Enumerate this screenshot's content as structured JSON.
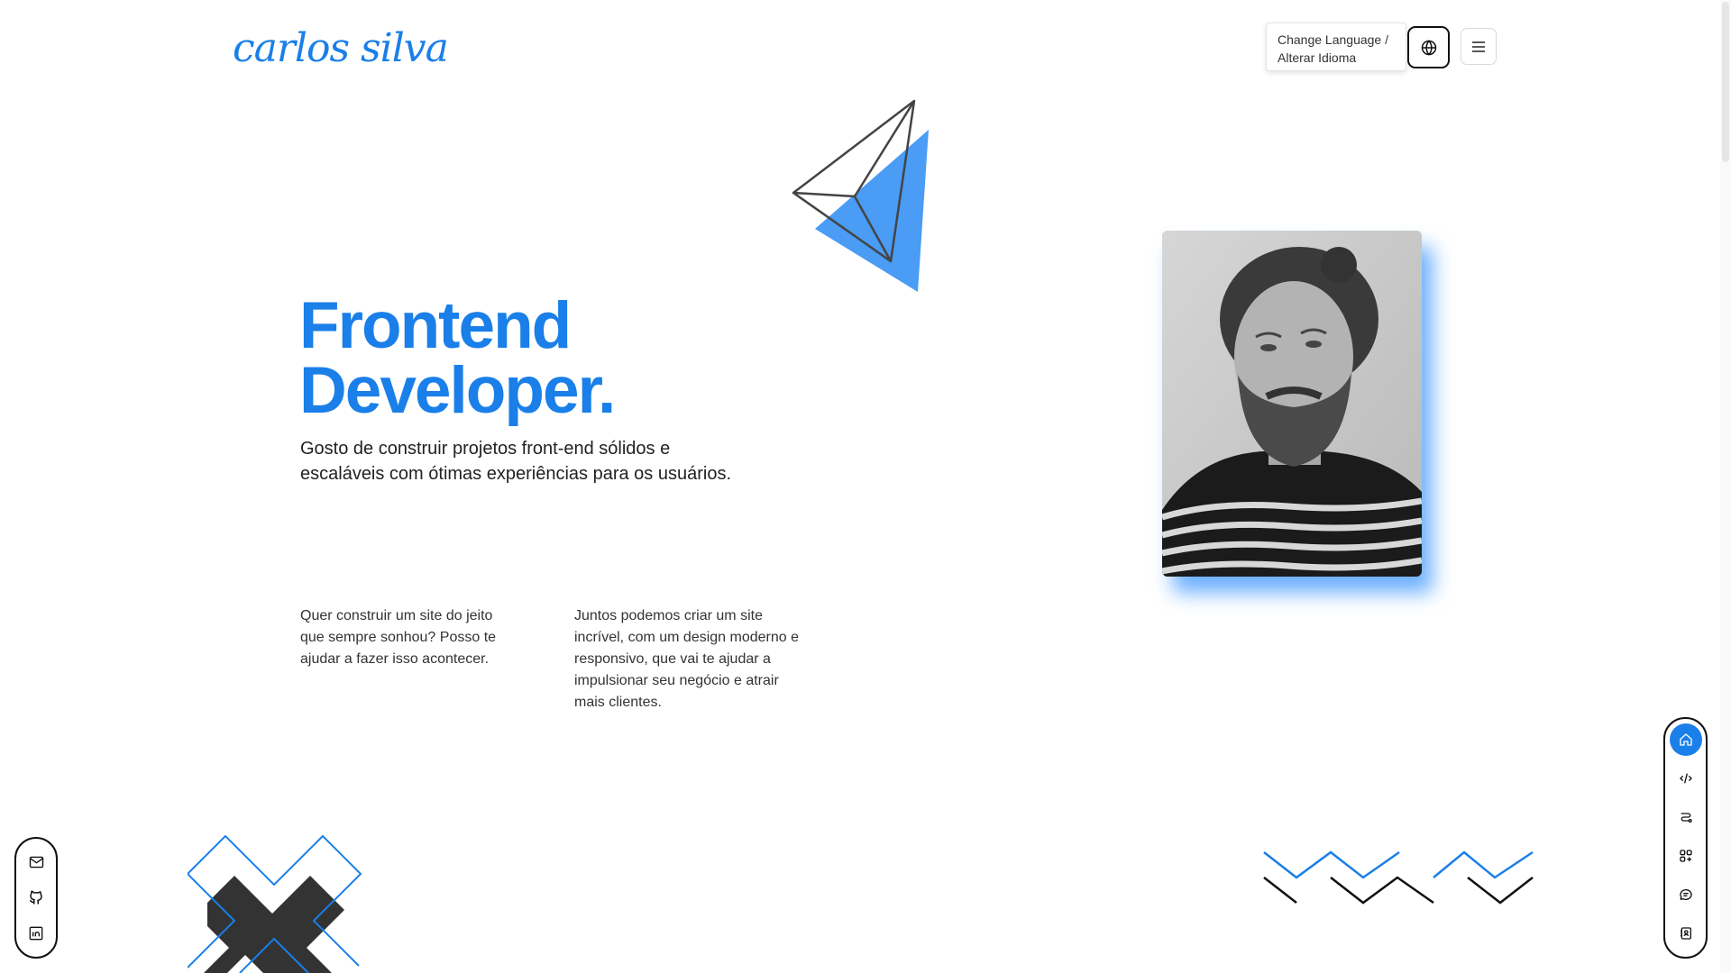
{
  "header": {
    "logo_text": "carlos silva",
    "language_tooltip_line1": "Change Language /",
    "language_tooltip_line2": "Alterar Idioma"
  },
  "hero": {
    "title_line1": "Frontend",
    "title_line2": "Developer.",
    "subtitle": "Gosto de construir projetos front-end sólidos e escaláveis com ótimas experiências para os usuários.",
    "column1": "Quer construir um site do jeito que sempre sonhou? Posso te ajudar a fazer isso acontecer.",
    "column2": "Juntos podemos criar um site incrível, com um design moderno e responsivo, que vai te ajudar a impulsionar seu negócio e atrair mais clientes."
  },
  "colors": {
    "accent": "#1a7fe8",
    "accent_light": "#4a9cf5",
    "dark_shape": "#333333"
  },
  "icons": {
    "language": "globe-icon",
    "menu": "menu-icon",
    "social": [
      "mail-icon",
      "github-icon",
      "linkedin-icon"
    ],
    "nav": [
      "home-icon",
      "code-icon",
      "route-icon",
      "apps-icon",
      "chat-icon",
      "contact-icon"
    ]
  },
  "nav": {
    "active_index": 0
  }
}
